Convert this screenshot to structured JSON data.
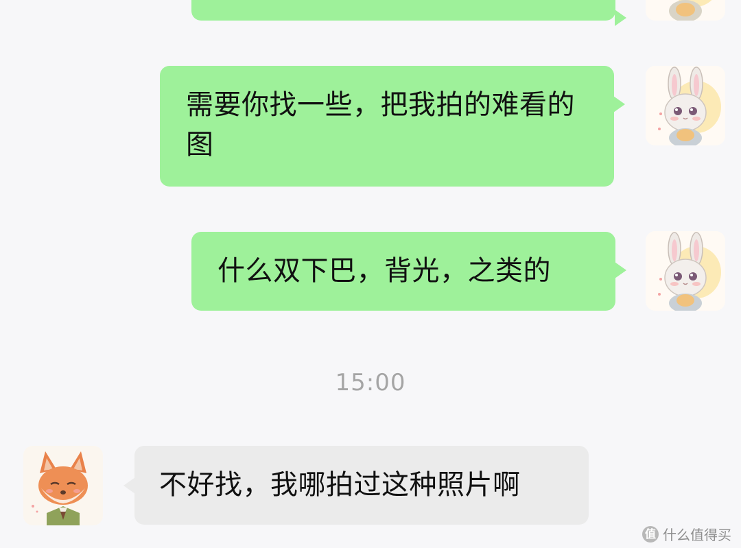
{
  "messages": [
    {
      "id": "m1",
      "direction": "outgoing",
      "text": ""
    },
    {
      "id": "m2",
      "direction": "outgoing",
      "text": "需要你找一些，把我拍的难看的图"
    },
    {
      "id": "m3",
      "direction": "outgoing",
      "text": "什么双下巴，背光，之类的"
    },
    {
      "id": "m4",
      "direction": "incoming",
      "text": "不好找，我哪拍过这种照片啊"
    }
  ],
  "time_divider": "15:00",
  "watermark": {
    "badge": "值",
    "text": "什么值得买"
  },
  "colors": {
    "outgoing_bubble": "#9ef19a",
    "incoming_bubble": "#ebebeb",
    "background": "#f7f7f9",
    "timestamp": "#a5a5a5"
  },
  "icons": {
    "self_avatar": "bunny-avatar-icon",
    "contact_avatar": "fox-avatar-icon"
  }
}
